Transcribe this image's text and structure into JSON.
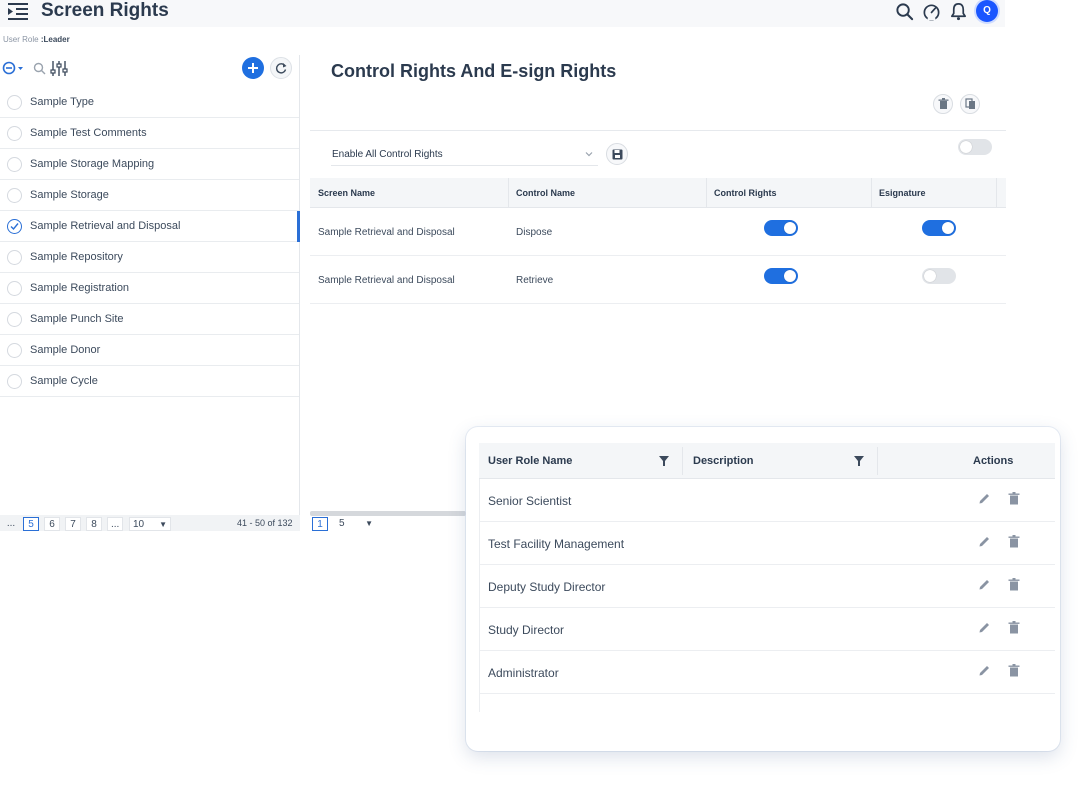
{
  "header": {
    "title": "Screen Rights",
    "avatar_initial": "Q",
    "accent": "#1a56ff"
  },
  "breadcrumb": {
    "label": "User Role",
    "value": ":Leader"
  },
  "sidebar": {
    "items": [
      {
        "label": "Sample Type",
        "checked": false
      },
      {
        "label": "Sample Test Comments",
        "checked": false
      },
      {
        "label": "Sample Storage Mapping",
        "checked": false
      },
      {
        "label": "Sample Storage",
        "checked": false
      },
      {
        "label": "Sample Retrieval and Disposal",
        "checked": true
      },
      {
        "label": "Sample Repository",
        "checked": false
      },
      {
        "label": "Sample Registration",
        "checked": false
      },
      {
        "label": "Sample Punch Site",
        "checked": false
      },
      {
        "label": "Sample Donor",
        "checked": false
      },
      {
        "label": "Sample Cycle",
        "checked": false
      }
    ],
    "pager": {
      "ellipsis_start": "...",
      "pages": [
        "5",
        "6",
        "7",
        "8"
      ],
      "current": "5",
      "ellipsis_end": "...",
      "page_size": "10",
      "range": "41 - 50 of 132"
    }
  },
  "main": {
    "title": "Control Rights And E-sign Rights",
    "enable_select": "Enable All Control Rights",
    "enable_all_on": false,
    "table": {
      "headers": [
        "Screen Name",
        "Control Name",
        "Control Rights",
        "Esignature"
      ],
      "rows": [
        {
          "screen": "Sample Retrieval and Disposal",
          "control": "Dispose",
          "control_rights": true,
          "esignature": true
        },
        {
          "screen": "Sample Retrieval and Disposal",
          "control": "Retrieve",
          "control_rights": true,
          "esignature": false
        }
      ]
    },
    "pager": {
      "current": "1",
      "page_size": "5"
    }
  },
  "card": {
    "headers": [
      "User Role Name",
      "Description",
      "Actions"
    ],
    "rows": [
      {
        "name": "Senior Scientist"
      },
      {
        "name": "Test Facility Management"
      },
      {
        "name": "Deputy Study Director"
      },
      {
        "name": "Study Director"
      },
      {
        "name": "Administrator"
      }
    ]
  }
}
